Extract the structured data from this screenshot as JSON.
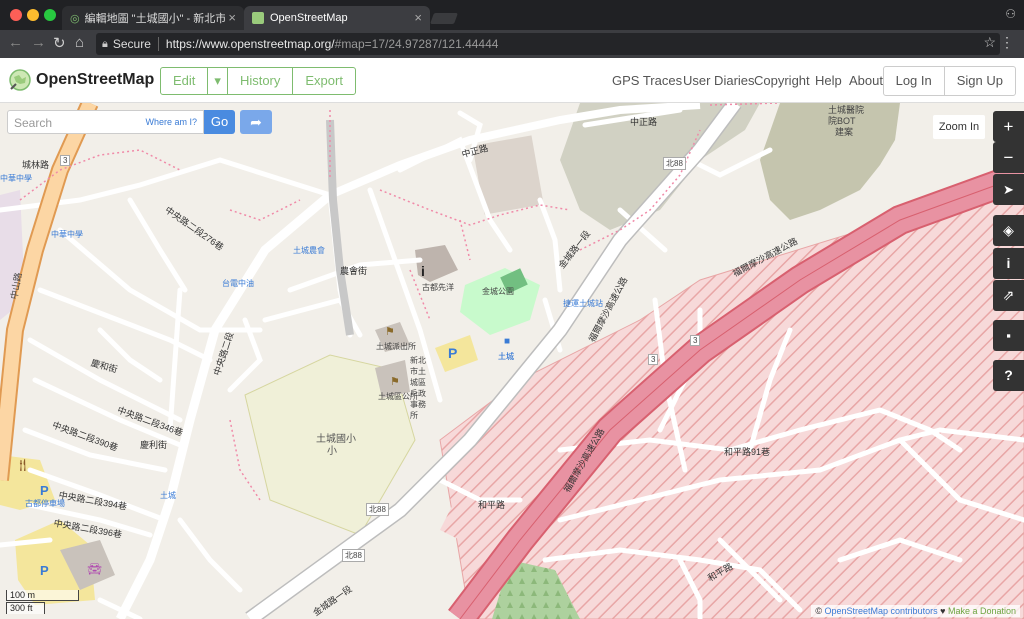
{
  "browser": {
    "tabs": [
      {
        "title": "編輯地圖 \"土城國小\" - 新北市土"
      },
      {
        "title": "OpenStreetMap"
      }
    ],
    "address": {
      "secure_label": "Secure",
      "host": "https://www.openstreetmap.org/",
      "path": "#map=17/24.97287/121.44444"
    }
  },
  "header": {
    "site_name": "OpenStreetMap",
    "edit": "Edit",
    "history": "History",
    "export": "Export",
    "nav": [
      "GPS Traces",
      "User Diaries",
      "Copyright",
      "Help",
      "About"
    ],
    "login": "Log In",
    "signup": "Sign Up"
  },
  "search": {
    "placeholder": "Search",
    "where": "Where am I?",
    "go": "Go"
  },
  "map": {
    "zoom_hint": "Zoom In",
    "controls": [
      "zoom-in",
      "zoom-out",
      "locate",
      "layers",
      "info",
      "share",
      "note",
      "help"
    ],
    "scale_metric": "100 m",
    "scale_imperial": "300 ft",
    "attribution_prefix": "©",
    "attribution_link": "OpenStreetMap contributors",
    "attribution_heart": "♥",
    "attribution_donate": "Make a Donation",
    "labels": {
      "school": "土城國小",
      "school2": "小",
      "trading_post": "古都先洋",
      "center": "土城",
      "freeway1": "福爾摩沙高速公路",
      "freeway2": "福爾摩沙高速公路",
      "freeway3": "福爾摩沙高速公路",
      "heping_rd": "和平路",
      "heping_lane": "和平路91巷",
      "heping_rd2": "和平路",
      "jincheng": "金城路一段",
      "jincheng2": "金城路一段",
      "zhongzheng": "中正路",
      "zhongzheng2": "中正路",
      "zhongyang": "中央路二段",
      "zhongyang346": "中央路二段346巷",
      "zhongyang390": "中央路二段390巷",
      "zhongyang394": "中央路二段394巷",
      "zhongyang396": "中央路二段396巷",
      "zhongyang276": "中央路二段276巷",
      "qinghe": "慶和街",
      "qingli": "慶利街",
      "nongxun": "農會街",
      "chengzhong": "城林路",
      "hospital": "土城醫院",
      "hospital2": "院BOT",
      "hospital3": "建案",
      "tucheng_station": "捷運土城站",
      "police": "土城派出所",
      "district_office": "土城區公所",
      "household": "新北市土城區戶政事務所",
      "park": "金城公園",
      "farmers": "土城農會",
      "taiji": "台電中油",
      "zhonghua": "中華中學",
      "shuangzhong": "中華中學",
      "parking": "古都停車場",
      "route3": "3",
      "route3b": "3",
      "route3c": "3",
      "route_bei88": "北88",
      "route_bei88b": "北88",
      "route_bei88c": "北88",
      "tucheng_blue": "土城",
      "tucheng_blue2": "土城",
      "zhongshan": "中山路"
    }
  }
}
